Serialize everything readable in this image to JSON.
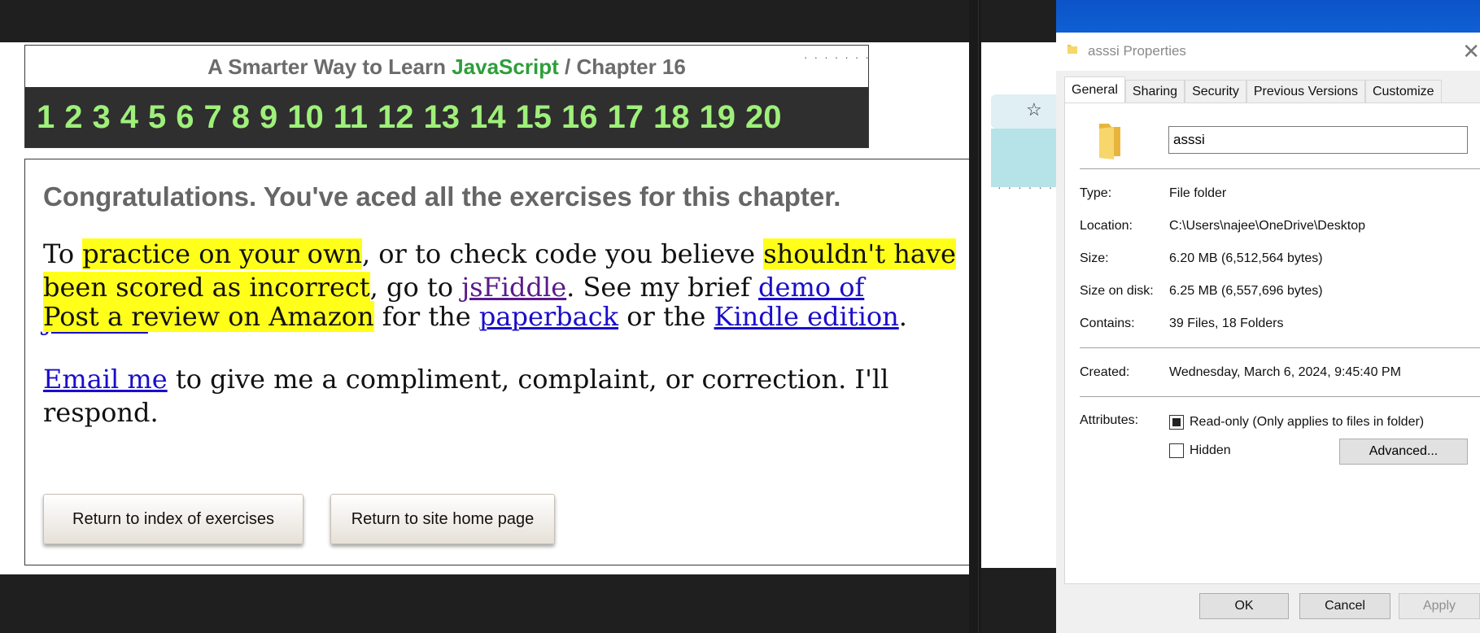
{
  "browser": {
    "header": {
      "title_pre": "A Smarter Way to Learn",
      "title_js": "JavaScript",
      "title_sep": "/",
      "title_chapter": "Chapter 16"
    },
    "chapters": [
      "1",
      "2",
      "3",
      "4",
      "5",
      "6",
      "7",
      "8",
      "9",
      "10",
      "11",
      "12",
      "13",
      "14",
      "15",
      "16",
      "17",
      "18",
      "19",
      "20"
    ],
    "content": {
      "congrats": "Congratulations. You've aced all the exercises for this chapter.",
      "p1": {
        "t1": "To ",
        "h1": "practice on your own",
        "t2": ", or to check code you believe ",
        "h2": "shouldn't have been scored as incorrect",
        "t3": ", go to ",
        "link1": "jsFiddle",
        "t4": ". See my brief ",
        "link2": "demo of jsFiddle",
        "t5": "."
      },
      "p2": {
        "h1": "Post a review on Amazon",
        "t1": " for the ",
        "link1": "paperback",
        "t2": " or the ",
        "link2": "Kindle edition",
        "t3": "."
      },
      "p3": {
        "link1": "Email me",
        "t1": " to give me a compliment, complaint, or correction. I'll respond."
      },
      "buttons": {
        "index": "Return to index of exercises",
        "home": "Return to site home page"
      }
    },
    "colors": {
      "highlight": "#ffff1a",
      "link": "#1a0dca",
      "visited_link": "#5a1a8c",
      "chapter_number": "#9ff07a",
      "javascript_green": "#2e9e3a"
    }
  },
  "background_window": {
    "icon": "star-icon"
  },
  "dialog": {
    "title": "asssi Properties",
    "tabs": [
      "General",
      "Sharing",
      "Security",
      "Previous Versions",
      "Customize"
    ],
    "active_tab": "General",
    "name_value": "asssi",
    "properties": {
      "type_label": "Type:",
      "type_value": "File folder",
      "location_label": "Location:",
      "location_value": "C:\\Users\\najee\\OneDrive\\Desktop",
      "size_label": "Size:",
      "size_value": "6.20 MB (6,512,564 bytes)",
      "size_on_disk_label": "Size on disk:",
      "size_on_disk_value": "6.25 MB (6,557,696 bytes)",
      "contains_label": "Contains:",
      "contains_value": "39 Files, 18 Folders",
      "created_label": "Created:",
      "created_value": "Wednesday, March 6, 2024, 9:45:40 PM",
      "attributes_label": "Attributes:"
    },
    "attributes": {
      "readonly_label": "Read-only (Only applies to files in folder)",
      "readonly_state": "indeterminate",
      "hidden_label": "Hidden",
      "hidden_checked": false,
      "advanced_label": "Advanced..."
    },
    "buttons": {
      "ok": "OK",
      "cancel": "Cancel",
      "apply": "Apply"
    },
    "colors": {
      "title_bar_accent": "#0c53c8",
      "folder_icon": "#f2c94c"
    }
  }
}
